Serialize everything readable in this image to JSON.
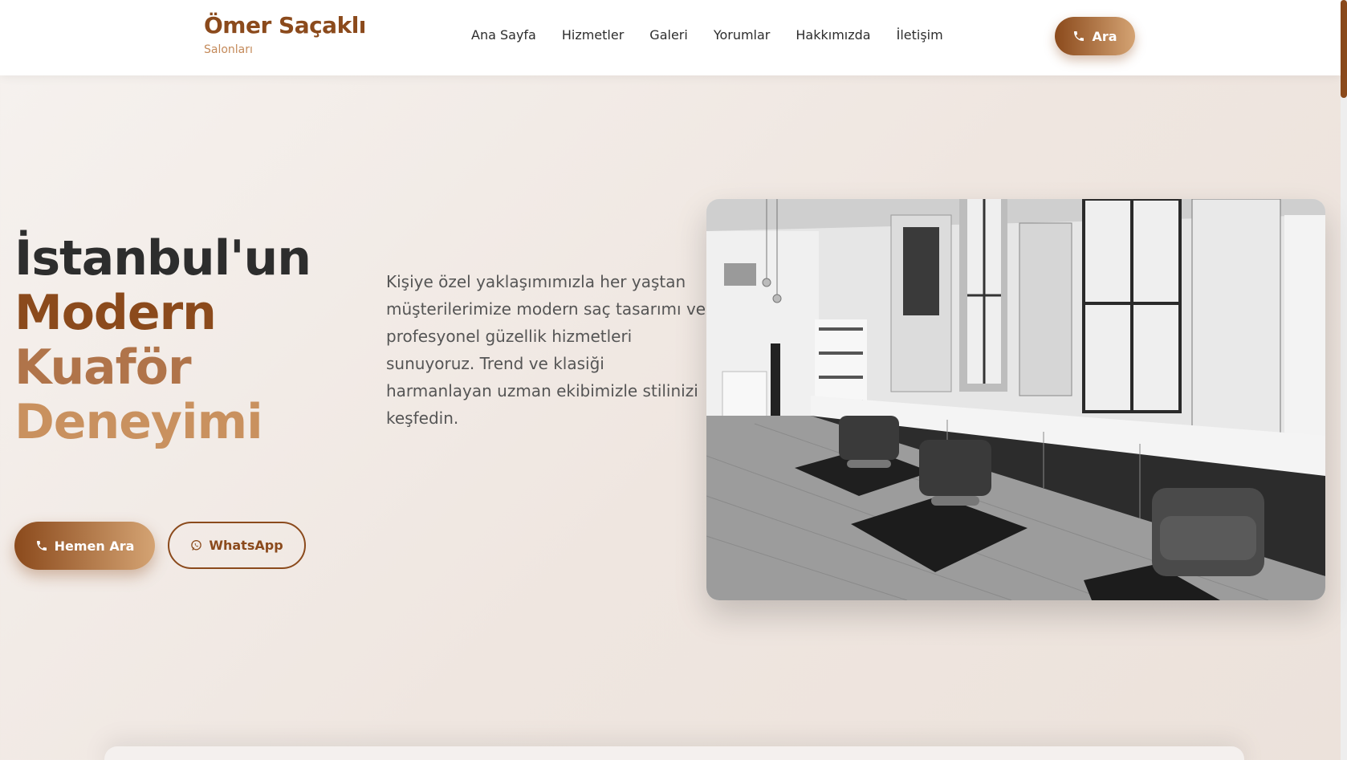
{
  "brand": {
    "title": "Ömer Saçaklı",
    "subtitle": "Salonları"
  },
  "nav": {
    "items": [
      "Ana Sayfa",
      "Hizmetler",
      "Galeri",
      "Yorumlar",
      "Hakkımızda",
      "İletişim"
    ]
  },
  "header_cta": {
    "label": "Ara",
    "icon": "phone-icon"
  },
  "hero": {
    "title_line1": "İstanbul'un",
    "title_line2": "Modern",
    "title_line3": "Kuaför",
    "title_line4": "Deneyimi",
    "description": "Kişiye özel yaklaşımımızla her yaştan müşterilerimize modern saç tasarımı ve profesyonel güzellik hizmetleri sunuyoruz. Trend ve klasiği harmanlayan uzman ekibimizle stilinizi keşfedin.",
    "primary_button": {
      "label": "Hemen Ara",
      "icon": "phone-icon"
    },
    "secondary_button": {
      "label": "WhatsApp",
      "icon": "whatsapp-icon"
    }
  },
  "colors": {
    "brand": "#8b4a1c",
    "accent": "#d4a373",
    "text_dark": "#2d2d2d",
    "background": "#f3ede9"
  }
}
